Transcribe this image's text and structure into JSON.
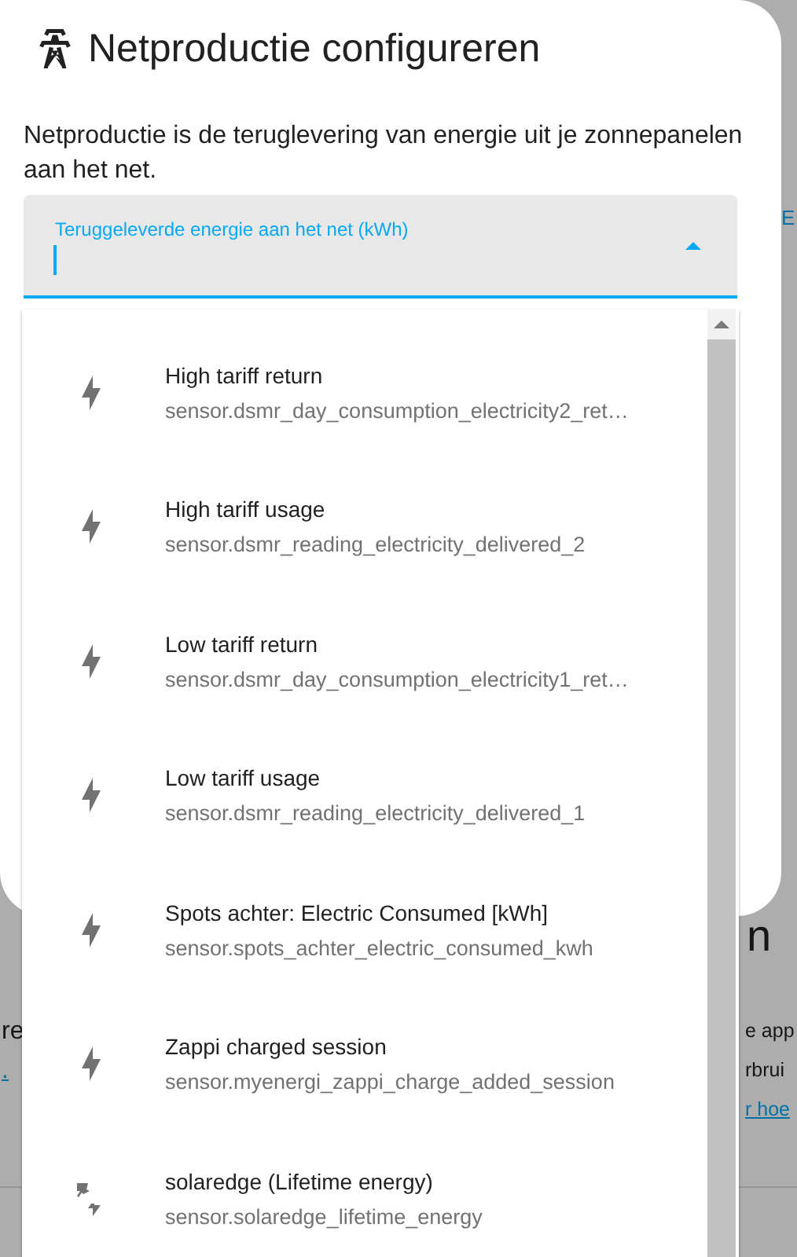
{
  "background_page": {
    "left_texts": [
      {
        "text": "re",
        "kind": "text"
      },
      {
        "text": ".",
        "kind": "link"
      }
    ],
    "right_heading": "n",
    "right_texts": [
      {
        "text": "e app",
        "kind": "text"
      },
      {
        "text": "rbrui",
        "kind": "text"
      },
      {
        "text": "r hoe",
        "kind": "link"
      }
    ],
    "top_right_link": "E"
  },
  "dialog": {
    "title": "Netproductie configureren",
    "description": "Netproductie is de teruglevering van energie uit je zonnepanelen aan het net.",
    "field": {
      "label": "Teruggeleverde energie aan het net (kWh)",
      "expanded": true
    },
    "options": [
      {
        "kind": "bolt",
        "title": "High tariff return",
        "entity": "sensor.dsmr_day_consumption_electricity2_ret…"
      },
      {
        "kind": "bolt",
        "title": "High tariff usage",
        "entity": "sensor.dsmr_reading_electricity_delivered_2"
      },
      {
        "kind": "bolt",
        "title": "Low tariff return",
        "entity": "sensor.dsmr_day_consumption_electricity1_ret…"
      },
      {
        "kind": "bolt",
        "title": "Low tariff usage",
        "entity": "sensor.dsmr_reading_electricity_delivered_1"
      },
      {
        "kind": "bolt",
        "title": "Spots achter: Electric Consumed [kWh]",
        "entity": "sensor.spots_achter_electric_consumed_kwh"
      },
      {
        "kind": "bolt",
        "title": "Zappi charged session",
        "entity": "sensor.myenergi_zappi_charge_added_session"
      },
      {
        "kind": "solar",
        "title": "solaredge (Lifetime energy)",
        "entity": "sensor.solaredge_lifetime_energy"
      }
    ]
  }
}
